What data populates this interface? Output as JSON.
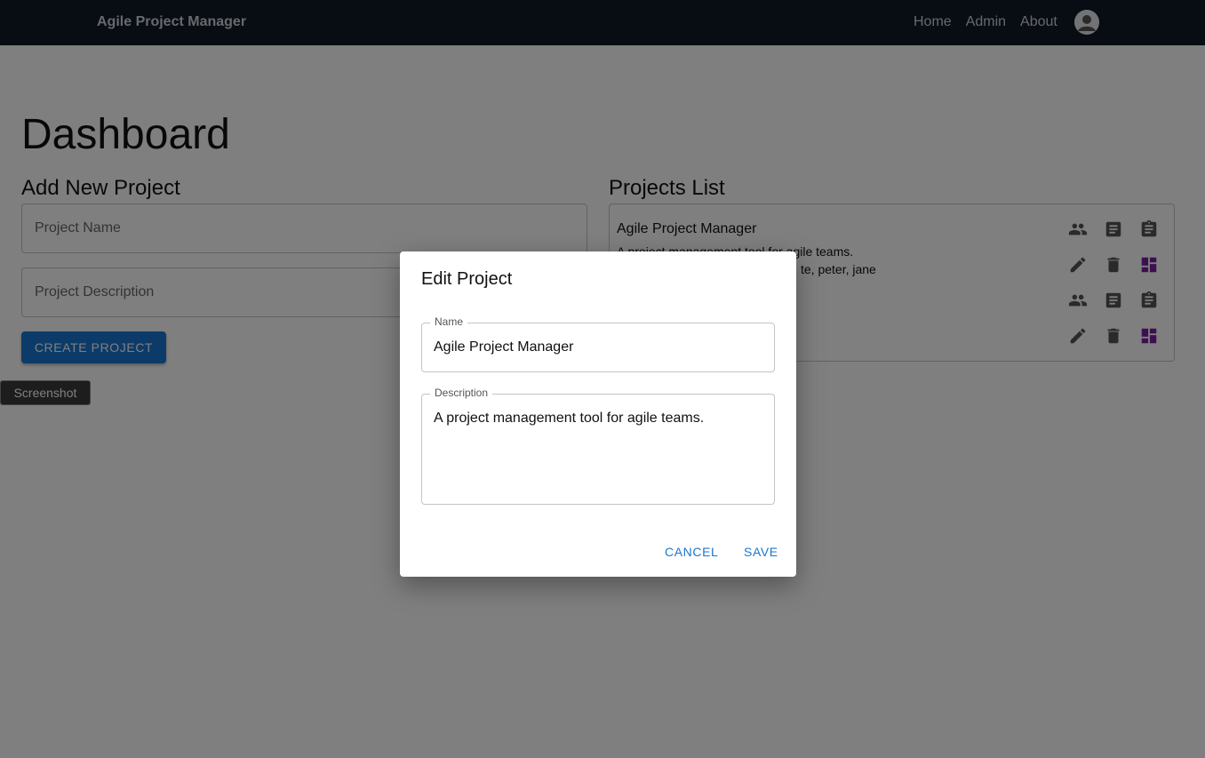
{
  "navbar": {
    "brand": "Agile Project Manager",
    "links": [
      "Home",
      "Admin",
      "About"
    ]
  },
  "dashboard": {
    "title": "Dashboard",
    "add_section": {
      "title": "Add New Project",
      "name_placeholder": "Project Name",
      "description_placeholder": "Project Description",
      "create_label": "CREATE PROJECT"
    },
    "list_section": {
      "title": "Projects List",
      "project": {
        "name": "Agile Project Manager",
        "description": "A project management tool for agile teams.",
        "members_visible": "te, peter, jane"
      }
    }
  },
  "screenshot_button": "Screenshot",
  "dialog": {
    "title": "Edit Project",
    "name_label": "Name",
    "name_value": "Agile Project Manager",
    "description_label": "Description",
    "description_value": "A project management tool for agile teams.",
    "cancel_label": "CANCEL",
    "save_label": "SAVE"
  },
  "colors": {
    "navbar": "#111827",
    "primary": "#1976d2",
    "board_icon": "#7b1fa2"
  },
  "icons": [
    "people-icon",
    "notes-icon",
    "clipboard-icon",
    "edit-icon",
    "delete-icon",
    "board-icon"
  ]
}
